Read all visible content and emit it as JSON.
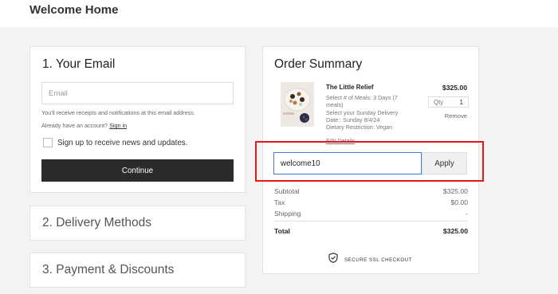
{
  "header": {
    "brand": "Welcome Home"
  },
  "email_section": {
    "title": "1.  Your Email",
    "email_placeholder": "Email",
    "email_value": "",
    "receipts_text": "You'll receive receipts and notifications at this email address.",
    "account_prompt": "Already have an account?",
    "signin_label": "Sign in",
    "newsletter_label": "Sign up to receive news and updates.",
    "newsletter_checked": false,
    "continue_label": "Continue"
  },
  "delivery_section": {
    "title": "2.  Delivery Methods"
  },
  "payment_section": {
    "title": "3.  Payment & Discounts"
  },
  "summary": {
    "title": "Order Summary",
    "item": {
      "name": "The Little Relief",
      "price": "$325.00",
      "details": [
        "Select # of Meals: 3 Days (7 meals)",
        "Select your Sunday Delivery Date:: Sunday 8/4/24",
        "Dietary Restriction: Vegan"
      ],
      "edit_label": "Edit Details",
      "qty_label": "Qty",
      "qty_value": "1",
      "remove_label": "Remove"
    },
    "coupon": {
      "value": "welcome10",
      "apply_label": "Apply"
    },
    "rows": {
      "subtotal_label": "Subtotal",
      "subtotal_value": "$325.00",
      "tax_label": "Tax",
      "tax_value": "$0.00",
      "shipping_label": "Shipping",
      "shipping_value": "-",
      "total_label": "Total",
      "total_value": "$325.00"
    },
    "secure_label": "SECURE SSL CHECKOUT"
  },
  "icons": {
    "secure": "shield-check-icon"
  },
  "colors": {
    "highlight": "#e4171b",
    "focus": "#3b82d6",
    "button": "#2b2b2b"
  }
}
